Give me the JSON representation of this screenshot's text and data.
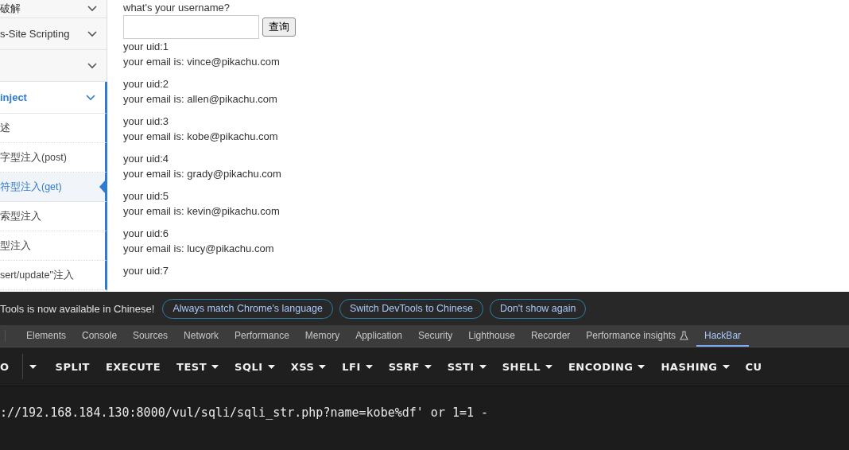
{
  "sidebar": {
    "sections": [
      {
        "label": "破解",
        "active": false
      },
      {
        "label": "s-Site Scripting",
        "active": false
      },
      {
        "active": false
      },
      {
        "label": "inject",
        "active": true,
        "children": [
          {
            "label": "述",
            "selected": false
          },
          {
            "label": "字型注入(post)",
            "selected": false
          },
          {
            "label": "符型注入(get)",
            "selected": true
          },
          {
            "label": "索型注入",
            "selected": false
          },
          {
            "label": "型注入",
            "selected": false
          },
          {
            "label": "sert/update\"注入",
            "selected": false
          }
        ]
      }
    ]
  },
  "content": {
    "prompt": "what's your username?",
    "submit": "查询",
    "results": [
      {
        "uid": "your uid:1",
        "email": "your email is: vince@pikachu.com"
      },
      {
        "uid": "your uid:2",
        "email": "your email is: allen@pikachu.com"
      },
      {
        "uid": "your uid:3",
        "email": "your email is: kobe@pikachu.com"
      },
      {
        "uid": "your uid:4",
        "email": "your email is: grady@pikachu.com"
      },
      {
        "uid": "your uid:5",
        "email": "your email is: kevin@pikachu.com"
      },
      {
        "uid": "your uid:6",
        "email": "your email is: lucy@pikachu.com"
      },
      {
        "uid": "your uid:7"
      }
    ]
  },
  "devtools": {
    "notice": {
      "text": "Tools is now available in Chinese!",
      "buttons": [
        "Always match Chrome's language",
        "Switch DevTools to Chinese",
        "Don't show again"
      ]
    },
    "tabs": [
      {
        "label": "Elements",
        "selected": false
      },
      {
        "label": "Console",
        "selected": false
      },
      {
        "label": "Sources",
        "selected": false
      },
      {
        "label": "Network",
        "selected": false
      },
      {
        "label": "Performance",
        "selected": false
      },
      {
        "label": "Memory",
        "selected": false
      },
      {
        "label": "Application",
        "selected": false
      },
      {
        "label": "Security",
        "selected": false
      },
      {
        "label": "Lighthouse",
        "selected": false
      },
      {
        "label": "Recorder",
        "selected": false
      },
      {
        "label": "Performance insights",
        "selected": false,
        "experimental": true
      },
      {
        "label": "HackBar",
        "selected": true
      }
    ],
    "hackbar": {
      "toolbar": [
        {
          "label": "O",
          "dropdown": false
        },
        {
          "dropdown": true
        },
        {
          "label": "SPLIT",
          "dropdown": false
        },
        {
          "label": "EXECUTE",
          "dropdown": false
        },
        {
          "label": "TEST",
          "dropdown": true
        },
        {
          "label": "SQLI",
          "dropdown": true
        },
        {
          "label": "XSS",
          "dropdown": true
        },
        {
          "label": "LFI",
          "dropdown": true
        },
        {
          "label": "SSRF",
          "dropdown": true
        },
        {
          "label": "SSTI",
          "dropdown": true
        },
        {
          "label": "SHELL",
          "dropdown": true
        },
        {
          "label": "ENCODING",
          "dropdown": true
        },
        {
          "label": "HASHING",
          "dropdown": true
        },
        {
          "label": "CU",
          "dropdown": false
        }
      ],
      "url": "://192.168.184.130:8000/vul/sqli/sqli_str.php?name=kobe%df' or 1=1 -"
    }
  }
}
